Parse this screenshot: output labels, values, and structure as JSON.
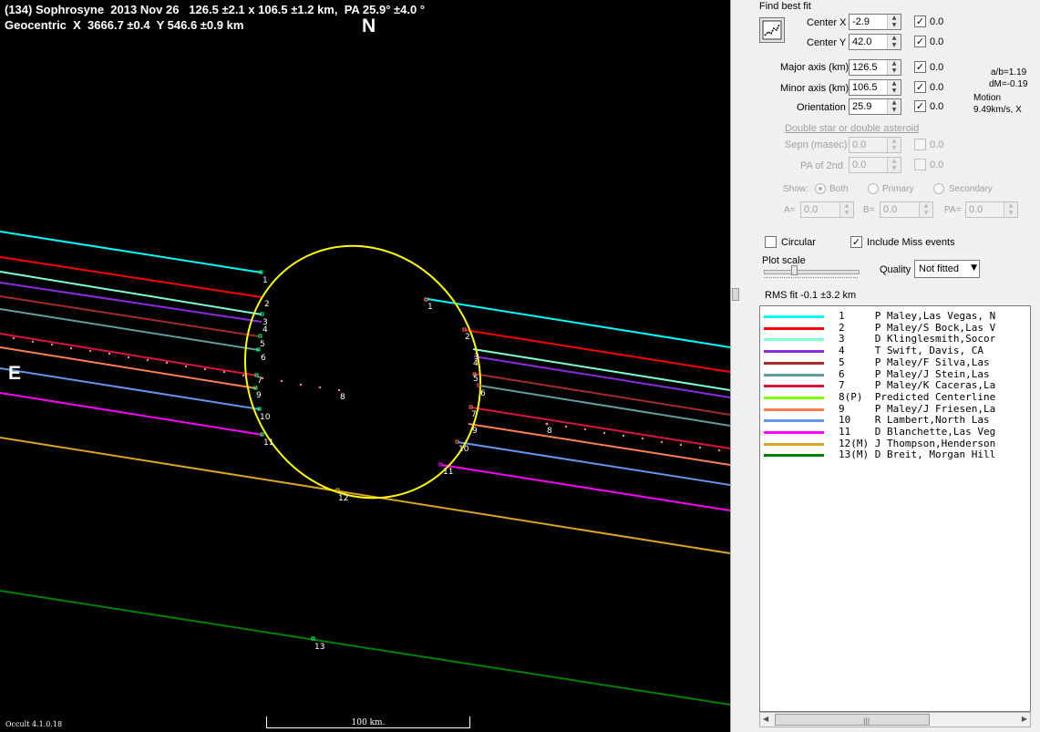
{
  "header": {
    "line1": "(134) Sophrosyne  2013 Nov 26   126.5 ±2.1 x 106.5 ±1.2 km,  PA 25.9° ±4.0 °",
    "line2": "Geocentric  X  3666.7 ±0.4  Y 546.6 ±0.9 km"
  },
  "compass": {
    "north": "N",
    "east": "E"
  },
  "version": "Occult 4.1.0.18",
  "scale_label": "100 km.",
  "chord_labels": {
    "west": [
      "1",
      "2",
      "3",
      "4",
      "5",
      "6",
      "7",
      "8",
      "9",
      "10",
      "11",
      "12",
      "13"
    ],
    "east": [
      "1",
      "2",
      "3",
      "4",
      "5",
      "6",
      "7",
      "8",
      "9",
      "10",
      "11"
    ]
  },
  "panel": {
    "find_best_fit": "Find best fit",
    "center_x": {
      "label": "Center X",
      "value": "-2.9",
      "fit": true,
      "delta": "0.0"
    },
    "center_y": {
      "label": "Center Y",
      "value": "42.0",
      "fit": true,
      "delta": "0.0"
    },
    "major_axis": {
      "label": "Major axis (km)",
      "value": "126.5",
      "fit": true,
      "delta": "0.0"
    },
    "minor_axis": {
      "label": "Minor axis (km)",
      "value": "106.5",
      "fit": true,
      "delta": "0.0"
    },
    "orientation": {
      "label": "Orientation",
      "value": "25.9",
      "fit": true,
      "delta": "0.0"
    },
    "ratio": "a/b=1.19",
    "dm": "dM=-0.19",
    "motion_label": "Motion",
    "motion_value": "9.49km/s, X",
    "double_star_link": "Double star  or  double asteroid",
    "sepn": {
      "label": "Sepn (masec)",
      "value": "0.0",
      "delta": "0.0"
    },
    "pa2nd": {
      "label": "PA of 2nd",
      "value": "0.0",
      "delta": "0.0"
    },
    "show_label": "Show:",
    "show_options": [
      "Both",
      "Primary",
      "Secondary"
    ],
    "a_label": "A=",
    "a_value": "0.0",
    "b_label": "B=",
    "b_value": "0.0",
    "pa_label": "PA=",
    "pa_value": "0.0",
    "circular_label": "Circular",
    "include_miss_label": "Include Miss events",
    "plot_scale_label": "Plot scale",
    "quality_label": "Quality",
    "quality_value": "Not fitted",
    "rms_fit": "RMS fit -0.1 ±3.2 km"
  },
  "legend": [
    {
      "color": "#00ffff",
      "text": "1     P Maley,Las Vegas, N"
    },
    {
      "color": "#ff0000",
      "text": "2     P Maley/S Bock,Las V"
    },
    {
      "color": "#7fffd4",
      "text": "3     D Klinglesmith,Socor"
    },
    {
      "color": "#8a2be2",
      "text": "4     T Swift, Davis, CA"
    },
    {
      "color": "#a52a2a",
      "text": "5     P Maley/F Silva,Las "
    },
    {
      "color": "#5f9ea0",
      "text": "6     P Maley/J Stein,Las "
    },
    {
      "color": "#dc143c",
      "text": "7     P Maley/K Caceras,La"
    },
    {
      "color": "#7fff00",
      "text": "8(P)  Predicted Centerline"
    },
    {
      "color": "#ff7f50",
      "text": "9     P Maley/J Friesen,La"
    },
    {
      "color": "#6495ed",
      "text": "10    R Lambert,North Las "
    },
    {
      "color": "#ff00ff",
      "text": "11    D Blanchette,Las Veg"
    },
    {
      "color": "#daa520",
      "text": "12(M) J Thompson,Henderson"
    },
    {
      "color": "#008000",
      "text": "13(M) D Breit, Morgan Hill"
    }
  ]
}
